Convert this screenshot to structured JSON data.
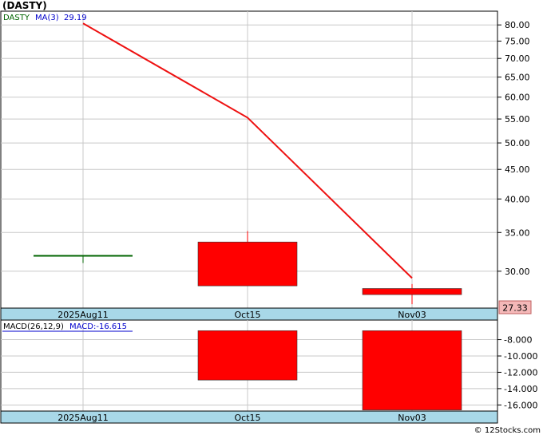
{
  "title": "(DASTY)",
  "price_panel": {
    "legend_symbol": "DASTY",
    "legend_ma_label": "MA(3)",
    "legend_ma_value": "29.19",
    "last_price_label": "27.33"
  },
  "macd_panel": {
    "legend_params": "MACD(26,12,9)",
    "legend_value": "MACD:-16.615"
  },
  "date_axis": [
    "2025Aug11",
    "Oct15",
    "Nov03"
  ],
  "footer": "© 12Stocks.com",
  "colors": {
    "background": "#ffffff",
    "axis_band": "#a8d8e8",
    "grid": "#c8c8c8",
    "candle_down": "#ff0000",
    "doji": "#006400",
    "ma_line": "#ee1111",
    "legend_symbol": "#006400",
    "legend_ma": "#0000cc",
    "last_price_box": "#f4b8b8"
  },
  "chart_data": [
    {
      "type": "candlestick",
      "x": [
        "2025Aug11",
        "Oct15",
        "Nov03"
      ],
      "candles": [
        {
          "date": "2025Aug11",
          "open": 31.9,
          "high": 31.9,
          "low": 31.0,
          "close": 31.9
        },
        {
          "date": "Oct15",
          "open": 33.7,
          "high": 35.2,
          "low": 28.3,
          "close": 28.3
        },
        {
          "date": "Nov03",
          "open": 28.0,
          "high": 28.5,
          "low": 26.3,
          "close": 27.33
        }
      ],
      "series": [
        {
          "name": "MA(3)",
          "type": "line",
          "values": [
            80.5,
            55.3,
            29.19
          ]
        }
      ],
      "y_ticks": [
        30,
        35,
        40,
        45,
        50,
        55,
        60,
        65,
        70,
        75,
        80
      ],
      "y_tick_labels": [
        "30.00",
        "35.00",
        "40.00",
        "45.00",
        "50.00",
        "55.00",
        "60.00",
        "65.00",
        "70.00",
        "75.00",
        "80.00"
      ],
      "y_scale": "log",
      "ylim": [
        25.9,
        84.5
      ],
      "grid": true
    },
    {
      "type": "bar",
      "x": [
        "2025Aug11",
        "Oct15",
        "Nov03"
      ],
      "series": [
        {
          "name": "MACD(26,12,9)",
          "values": [
            null,
            -12.95,
            -16.615
          ]
        }
      ],
      "bar_top": -6.9,
      "y_ticks": [
        -8,
        -10,
        -12,
        -14,
        -16
      ],
      "y_tick_labels": [
        "-8.000",
        "-10.000",
        "-12.000",
        "-14.000",
        "-16.000"
      ],
      "ylim": [
        -16.75,
        -5.6
      ],
      "grid": true
    }
  ]
}
